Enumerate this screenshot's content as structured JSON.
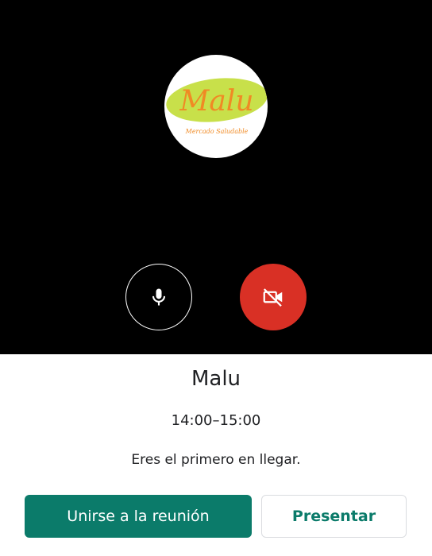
{
  "preview": {
    "avatar": {
      "logo_name": "Malu",
      "logo_tagline": "Mercado Saludable",
      "logo_text_color": "#f08a24",
      "logo_blob_color": "#c8e04a"
    },
    "mic": {
      "icon": "microphone-icon",
      "state": "on"
    },
    "camera": {
      "icon": "camera-off-icon",
      "state": "off",
      "color": "#d93025"
    }
  },
  "meeting": {
    "title": "Malu",
    "time": "14:00–15:00",
    "status": "Eres el primero en llegar."
  },
  "actions": {
    "join_label": "Unirse a la reunión",
    "present_label": "Presentar",
    "accent_color": "#0b7b6a"
  }
}
